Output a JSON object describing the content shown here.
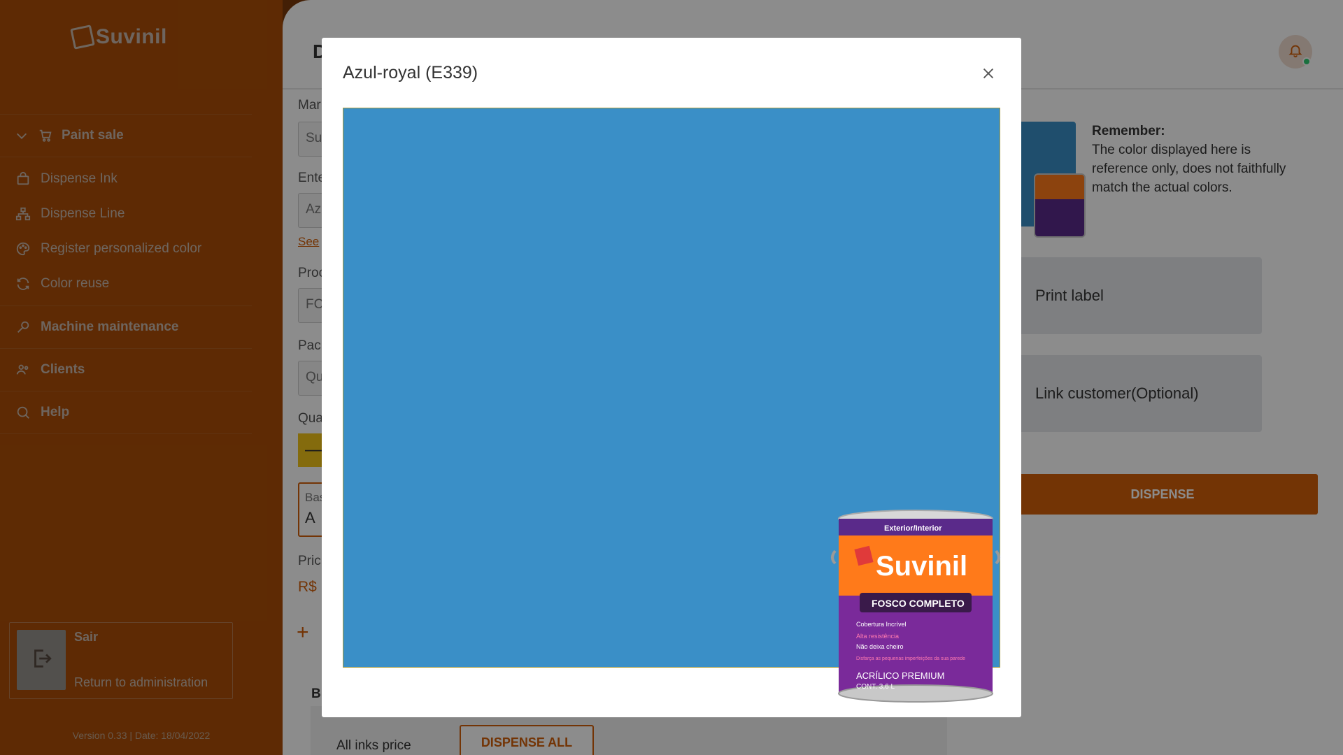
{
  "brand": {
    "name": "Suvinil"
  },
  "sidebar": {
    "group_label": "Paint sale",
    "sub_items": [
      {
        "label": "Dispense Ink",
        "icon": "bag-icon"
      },
      {
        "label": "Dispense Line",
        "icon": "hierarchy-icon"
      },
      {
        "label": "Register personalized color",
        "icon": "palette-icon"
      },
      {
        "label": "Color reuse",
        "icon": "refresh-icon"
      }
    ],
    "top_items": [
      {
        "label": "Machine maintenance",
        "icon": "wrench-icon"
      },
      {
        "label": "Clients",
        "icon": "users-icon"
      },
      {
        "label": "Help",
        "icon": "help-search-icon"
      }
    ],
    "exit": {
      "title": "Sair",
      "subtitle": "Return to administration"
    },
    "version": "Version 0.33 | Date: 18/04/2022"
  },
  "main": {
    "title_letter": "D",
    "labels": {
      "brand": "Mar",
      "enter": "Ente",
      "product": "Proc",
      "package": "Pacl",
      "quantity": "Qua",
      "price": "Pric"
    },
    "inputs": {
      "brand": "Su",
      "enter": "Az",
      "product": "FC",
      "package": "Qu"
    },
    "see_link": "See",
    "qty_minus": "—",
    "base": {
      "label": "Bas",
      "value": "A"
    },
    "price_value": "R$",
    "add_symbol": "+",
    "bottom_label": "B",
    "all_inks_price": "All inks price",
    "dispense_all": "DISPENSE ALL",
    "remember_title": "Remember:",
    "remember_text": "The color displayed here is reference only, does not faithfully match the actual colors.",
    "print_label": "Print label",
    "link_customer": "Link customer(Optional)",
    "dispense": "DISPENSE",
    "accent_color": "#d2600a"
  },
  "modal": {
    "title": "Azul-royal (E339)",
    "swatch_color": "#3a8fc7",
    "can": {
      "top": "Exterior/Interior",
      "brand": "Suvinil",
      "product": "FOSCO COMPLETO",
      "lines": [
        "Cobertura Incrível",
        "Alta resistência",
        "Não deixa cheiro",
        "Disfarça as pequenas imperfeições da sua parede"
      ],
      "finish": "ACRÍLICO PREMIUM",
      "volume": "CONT. 3,6 L"
    }
  }
}
